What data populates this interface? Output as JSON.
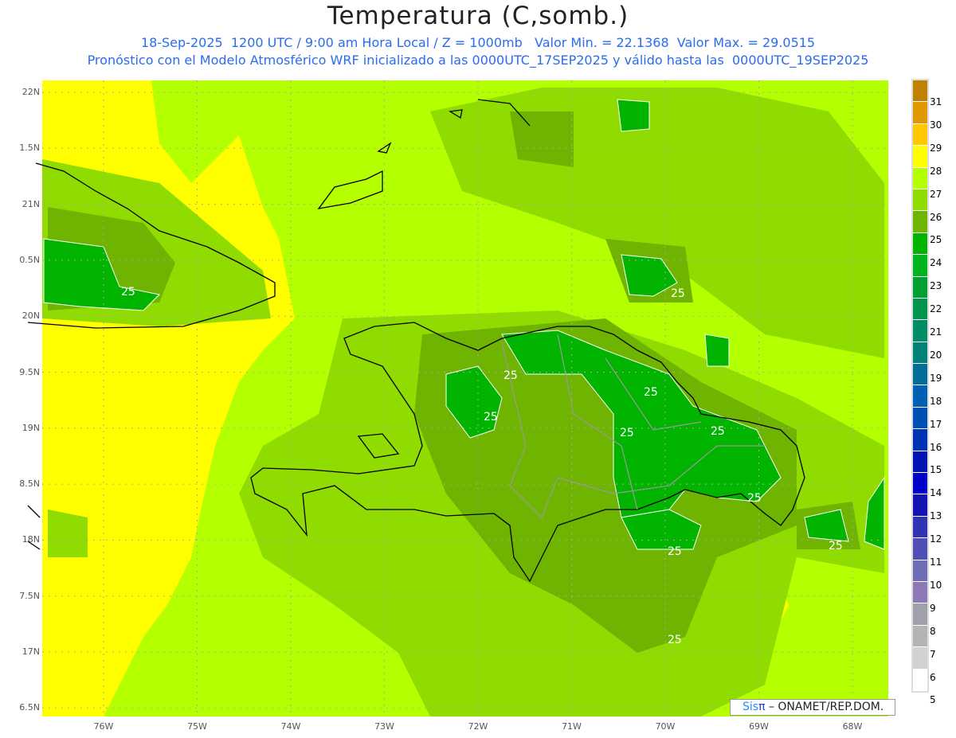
{
  "title": "Temperatura (C,somb.)",
  "subtitle1": "18-Sep-2025  1200 UTC / 9:00 am Hora Local / Z = 1000mb   Valor Min. = 22.1368  Valor Max. = 29.0515",
  "subtitle2": "Pronóstico con el Modelo Atmosférico WRF inicializado a las 0000UTC_17SEP2025 y válido hasta las  0000UTC_19SEP2025",
  "lat_labels": [
    "22N",
    "1.5N",
    "21N",
    "0.5N",
    "20N",
    "9.5N",
    "19N",
    "8.5N",
    "18N",
    "7.5N",
    "17N",
    "6.5N"
  ],
  "lon_labels": [
    "76W",
    "75W",
    "74W",
    "73W",
    "72W",
    "71W",
    "70W",
    "69W",
    "68W"
  ],
  "contour_labels": [
    "25",
    "25",
    "25",
    "25",
    "25",
    "25",
    "25",
    "25",
    "25",
    "25",
    "25"
  ],
  "colorbar": {
    "labels": [
      "31",
      "30",
      "29",
      "28",
      "27",
      "26",
      "25",
      "24",
      "23",
      "22",
      "21",
      "20",
      "19",
      "18",
      "17",
      "16",
      "15",
      "14",
      "13",
      "12",
      "11",
      "10",
      "9",
      "8",
      "7",
      "6",
      "5"
    ],
    "colors": [
      "#c08000",
      "#e09800",
      "#ffc800",
      "#ffff00",
      "#b4ff00",
      "#90dc00",
      "#6eb400",
      "#00b400",
      "#00b41e",
      "#00a032",
      "#009650",
      "#008c64",
      "#008278",
      "#006e96",
      "#0060b4",
      "#0050b4",
      "#0032b4",
      "#0014b4",
      "#0000c8",
      "#1414b4",
      "#3232b4",
      "#5050b4",
      "#6e6eb4",
      "#8c78b4",
      "#a0a0aa",
      "#b4b4b4",
      "#d2d2d2",
      "#ffffff"
    ]
  },
  "credit": {
    "brand": "Sis",
    "pi": "π",
    "rest": " – ONAMET/REP.DOM."
  }
}
